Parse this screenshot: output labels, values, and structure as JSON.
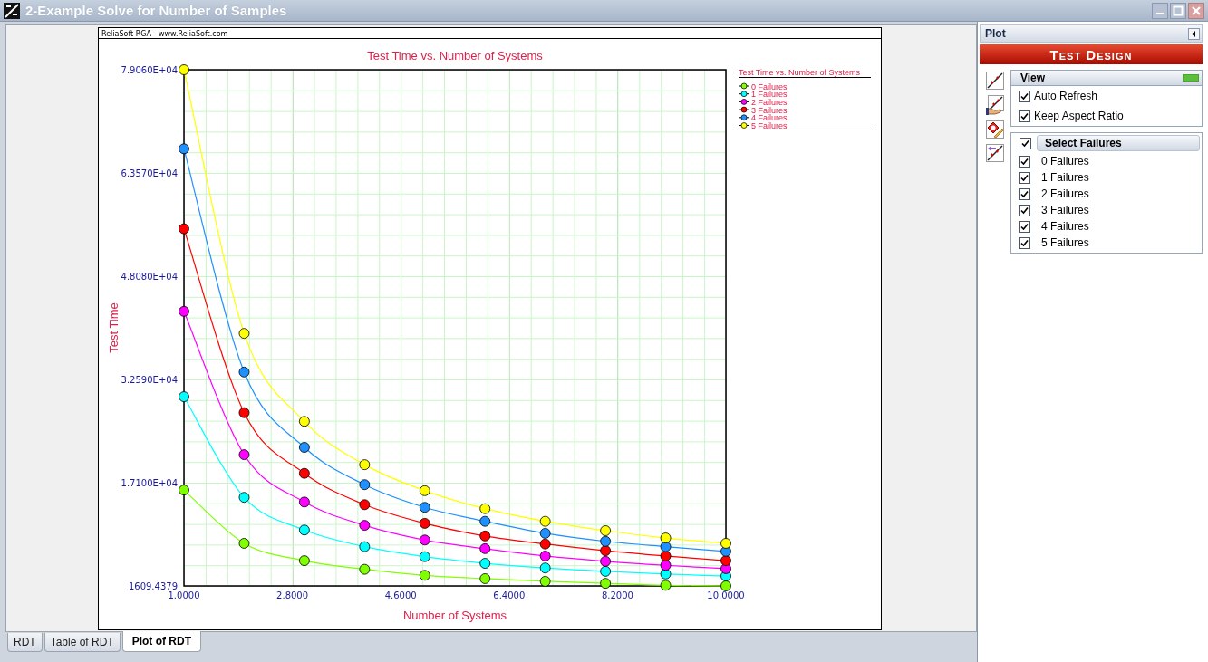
{
  "window": {
    "title": "2-Example Solve for Number of Samples"
  },
  "chart": {
    "header": "ReliaSoft RGA - www.ReliaSoft.com",
    "chart_data": {
      "type": "line",
      "title": "Test Time vs. Number of Systems",
      "xlabel": "Number of Systems",
      "ylabel": "Test Time",
      "x": [
        1,
        2,
        3,
        4,
        5,
        6,
        7,
        8,
        9,
        10
      ],
      "xlim": [
        1,
        10
      ],
      "ylim": [
        1609.4379,
        79060
      ],
      "xticks": [
        {
          "value": 1,
          "label": "1.0000"
        },
        {
          "value": 2.8,
          "label": "2.8000"
        },
        {
          "value": 4.6,
          "label": "4.6000"
        },
        {
          "value": 6.4,
          "label": "6.4000"
        },
        {
          "value": 8.2,
          "label": "8.2000"
        },
        {
          "value": 10,
          "label": "10.0000"
        }
      ],
      "yticks": [
        {
          "value": 1609.4379,
          "label": "1609.4379"
        },
        {
          "value": 17100,
          "label": "1.7100E+04"
        },
        {
          "value": 32590,
          "label": "3.2590E+04"
        },
        {
          "value": 48080,
          "label": "4.8080E+04"
        },
        {
          "value": 63570,
          "label": "6.3570E+04"
        },
        {
          "value": 79060,
          "label": "7.9060E+04"
        }
      ],
      "grid": {
        "major": true,
        "minor": true
      },
      "legend": {
        "title": "Test Time vs. Number of Systems"
      },
      "series": [
        {
          "name": "0 Failures",
          "color": "#80ff00",
          "marker": "circle",
          "values": [
            16000,
            8000,
            5400,
            4100,
            3200,
            2700,
            2300,
            2000,
            1700,
            1610
          ]
        },
        {
          "name": "1 Failures",
          "color": "#00ffff",
          "marker": "circle",
          "values": [
            30000,
            14900,
            10000,
            7500,
            6000,
            5000,
            4300,
            3800,
            3400,
            3100
          ]
        },
        {
          "name": "2 Failures",
          "color": "#ff00ff",
          "marker": "circle",
          "values": [
            42800,
            21300,
            14200,
            10700,
            8500,
            7200,
            6100,
            5300,
            4700,
            4200
          ]
        },
        {
          "name": "3 Failures",
          "color": "#ff0000",
          "marker": "circle",
          "values": [
            55200,
            27600,
            18500,
            13800,
            11000,
            9100,
            7900,
            6900,
            6100,
            5400
          ]
        },
        {
          "name": "4 Failures",
          "color": "#1e90ff",
          "marker": "circle",
          "values": [
            67200,
            33700,
            22400,
            16800,
            13400,
            11300,
            9500,
            8300,
            7500,
            6800
          ]
        },
        {
          "name": "5 Failures",
          "color": "#ffff00",
          "marker": "circle",
          "values": [
            79060,
            39500,
            26300,
            19800,
            15900,
            13200,
            11300,
            9900,
            8800,
            8000
          ]
        }
      ]
    }
  },
  "tabs": [
    {
      "label": "RDT",
      "selected": false
    },
    {
      "label": "Table of RDT",
      "selected": false
    },
    {
      "label": "Plot of RDT",
      "selected": true
    }
  ],
  "panel": {
    "title": "Plot",
    "banner": "Test Design",
    "view": {
      "title": "View",
      "options": [
        {
          "label": "Auto Refresh",
          "checked": true
        },
        {
          "label": "Keep Aspect Ratio",
          "checked": true
        }
      ]
    },
    "select": {
      "title": "Select Failures",
      "checked": true,
      "items": [
        {
          "label": "0 Failures",
          "checked": true
        },
        {
          "label": "1 Failures",
          "checked": true
        },
        {
          "label": "2 Failures",
          "checked": true
        },
        {
          "label": "3 Failures",
          "checked": true
        },
        {
          "label": "4 Failures",
          "checked": true
        },
        {
          "label": "5 Failures",
          "checked": true
        }
      ]
    }
  }
}
